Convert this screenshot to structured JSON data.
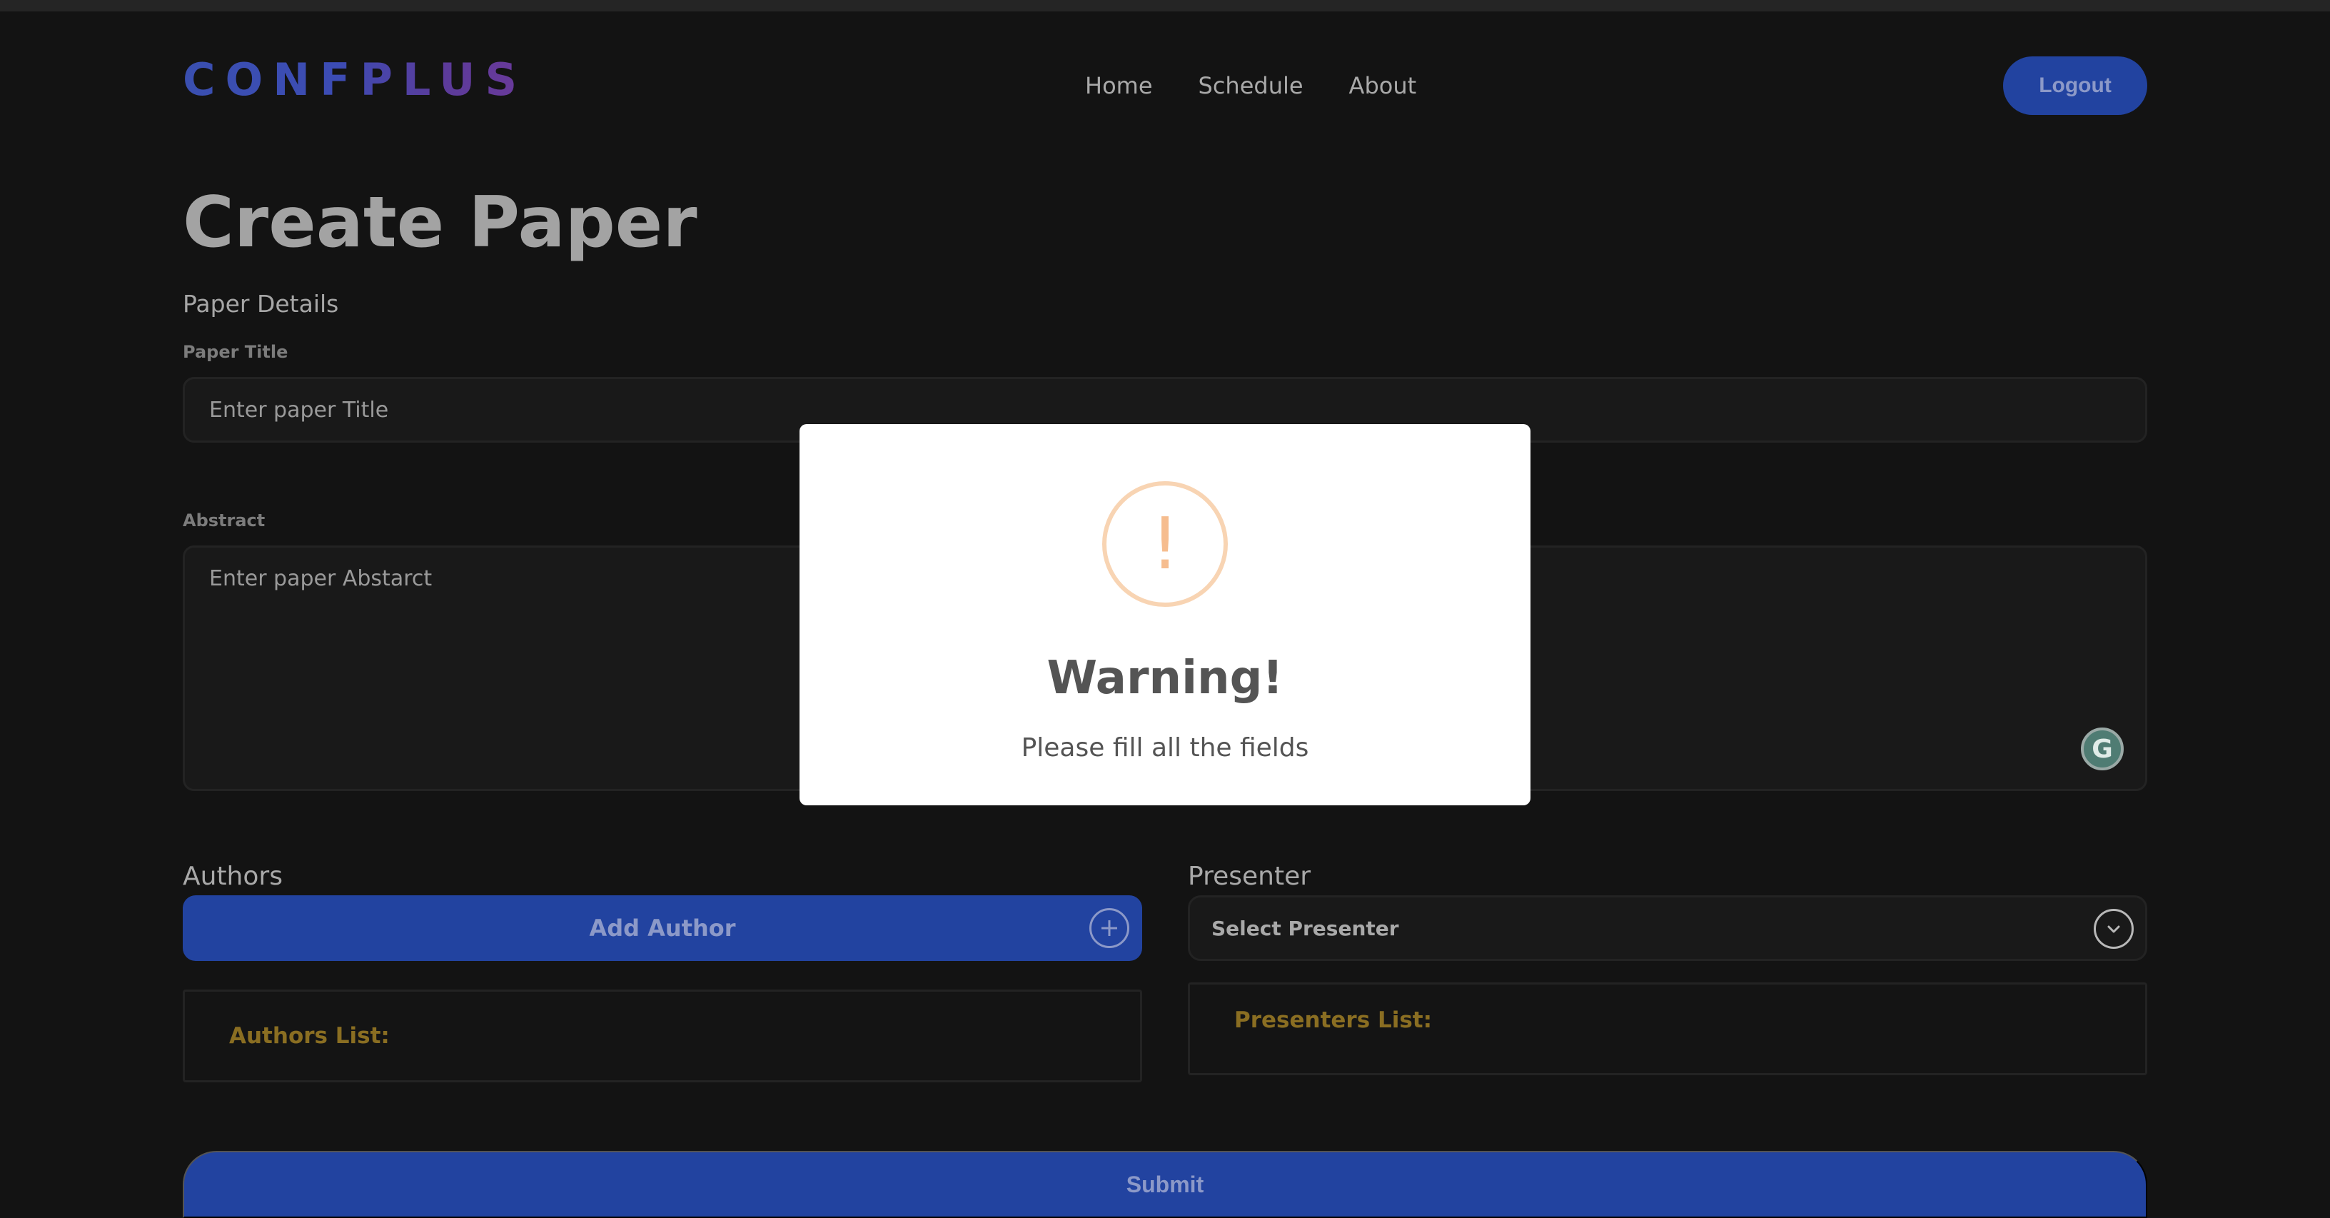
{
  "header": {
    "logo_text": "CONFPLUS",
    "nav": [
      "Home",
      "Schedule",
      "About"
    ],
    "logout_label": "Logout"
  },
  "page": {
    "title": "Create Paper",
    "section_title": "Paper Details",
    "paper_title_label": "Paper Title",
    "paper_title_placeholder": "Enter paper Title",
    "abstract_label": "Abstract",
    "abstract_placeholder": "Enter paper Abstarct"
  },
  "authors": {
    "title": "Authors",
    "add_label": "Add Author",
    "list_label": "Authors List:"
  },
  "presenter": {
    "title": "Presenter",
    "select_label": "Select Presenter",
    "list_label": "Presenters List:"
  },
  "submit_label": "Submit",
  "modal": {
    "icon": "warning-icon",
    "icon_glyph": "!",
    "title": "Warning!",
    "message": "Please fill all the fields"
  },
  "colors": {
    "background": "#131313",
    "accent_blue": "#2243a0",
    "list_label_gold": "#8a6e22",
    "warning_orange": "#f8d4b3"
  }
}
